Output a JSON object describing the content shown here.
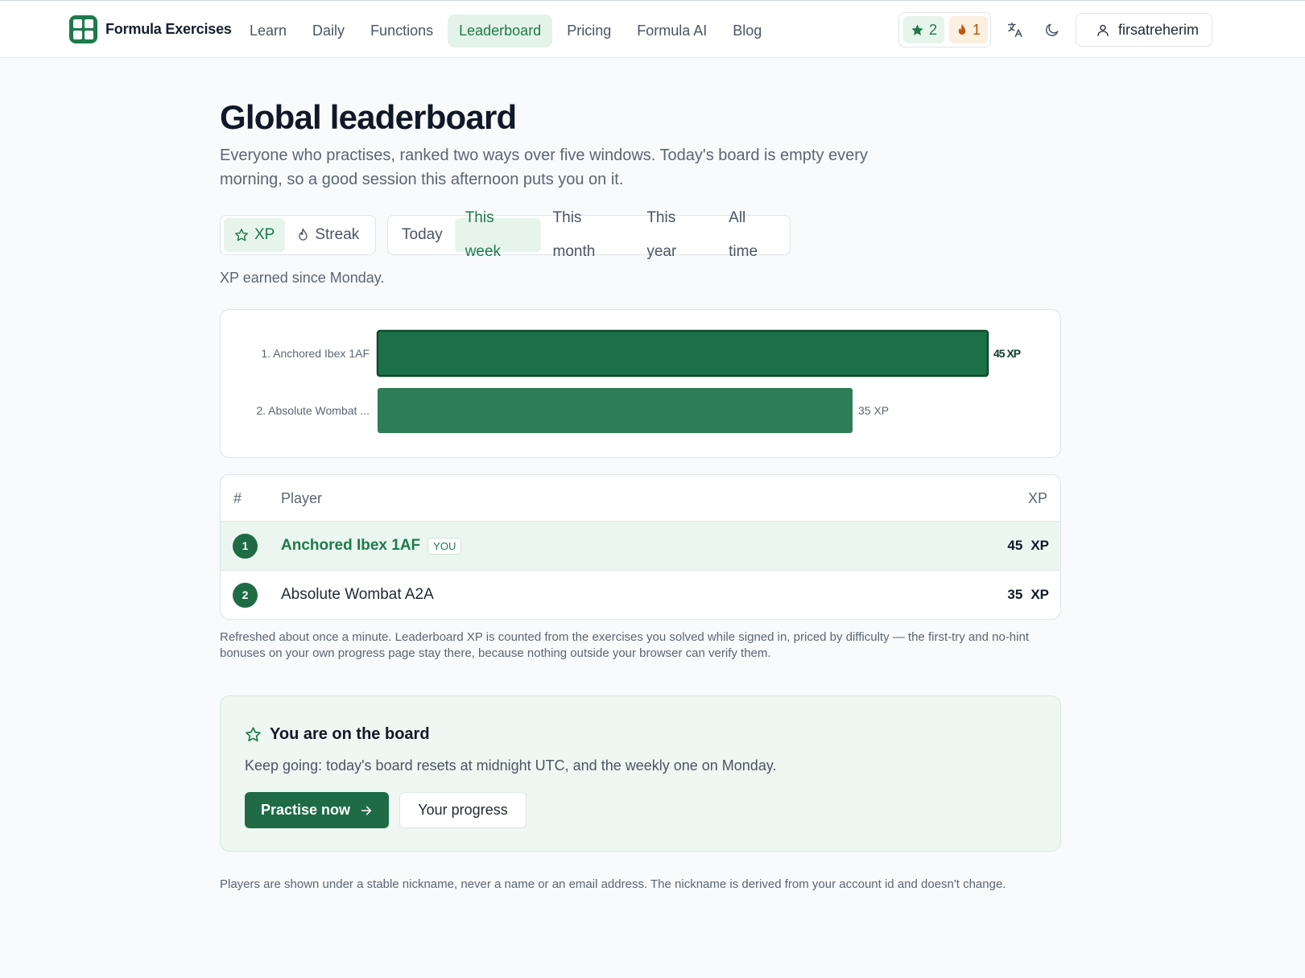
{
  "header": {
    "brand": "Formula Exercises",
    "nav": [
      "Learn",
      "Daily",
      "Functions",
      "Leaderboard",
      "Pricing",
      "Formula AI",
      "Blog"
    ],
    "active_nav": "Leaderboard",
    "xp_count": "2",
    "streak_count": "1",
    "username": "firsatreherim",
    "icons": {
      "logo": "grid-logo-icon",
      "xp": "star-icon",
      "streak": "flame-icon",
      "translate": "translate-icon",
      "theme": "moon-icon",
      "user": "user-icon"
    }
  },
  "page": {
    "title": "Global leaderboard",
    "intro": "Everyone who practises, ranked two ways over five windows. Today's board is empty every morning, so a good session this afternoon puts you on it.",
    "metric_tabs": [
      "XP",
      "Streak"
    ],
    "active_metric": "XP",
    "window_tabs": [
      "Today",
      "This week",
      "This month",
      "This year",
      "All time"
    ],
    "active_window": "This week",
    "caption": "XP earned since Monday."
  },
  "chart_data": {
    "type": "bar",
    "orientation": "horizontal",
    "categories": [
      "1. Anchored Ibex 1AF",
      "2. Absolute Wombat ..."
    ],
    "values": [
      45,
      35
    ],
    "value_labels": [
      "45 XP",
      "35 XP"
    ],
    "highlight_index": 0,
    "colors": {
      "highlight": "#1b7048",
      "bar": "#2e7d57",
      "outline": "#0f4a2d"
    }
  },
  "table": {
    "headers": {
      "rank": "#",
      "player": "Player",
      "xp": "XP"
    },
    "rows": [
      {
        "rank": "1",
        "player": "Anchored Ibex 1AF",
        "tag": "YOU",
        "xp": "45",
        "unit": "XP"
      },
      {
        "rank": "2",
        "player": "Absolute Wombat A2A",
        "tag": "",
        "xp": "35",
        "unit": "XP"
      }
    ]
  },
  "footnote": "Refreshed about once a minute. Leaderboard XP is counted from the exercises you solved while signed in, priced by difficulty — the first-try and no-hint bonuses on your own progress page stay there, because nothing outside your browser can verify them.",
  "board_card": {
    "title": "You are on the board",
    "text": "Keep going: today's board resets at midnight UTC, and the weekly one on Monday.",
    "primary_button": "Practise now",
    "secondary_button": "Your progress"
  },
  "privacy_note": "Players are shown under a stable nickname, never a name or an email address. The nickname is derived from your account id and doesn't change.",
  "colors": {
    "accent": "#1e7a4c",
    "accent_dark": "#1e6b45",
    "accent_soft": "#e7f4ec",
    "streak": "#b45309"
  }
}
